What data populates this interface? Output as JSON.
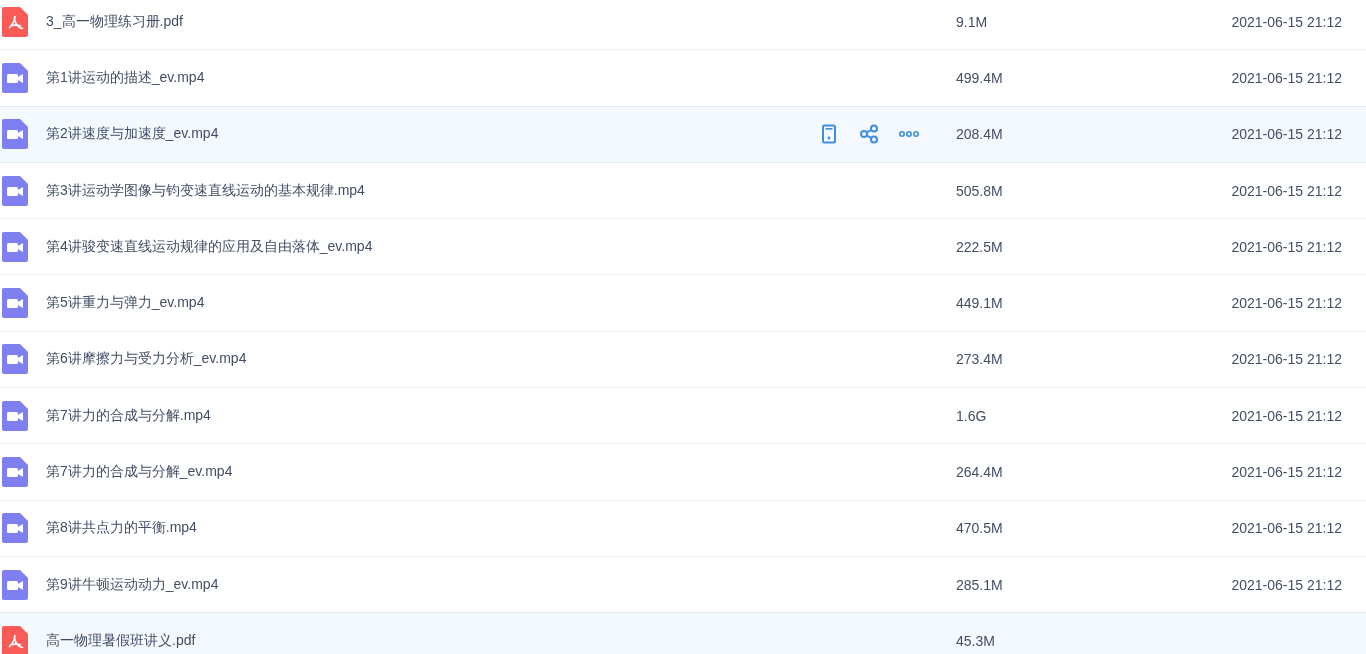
{
  "files": [
    {
      "kind": "pdf",
      "name": "3_高一物理练习册.pdf",
      "size": "9.1M",
      "date": "2021-06-15 21:12",
      "highlighted": false,
      "show_actions": false
    },
    {
      "kind": "video",
      "name": "第1讲运动的描述_ev.mp4",
      "size": "499.4M",
      "date": "2021-06-15 21:12",
      "highlighted": false,
      "show_actions": false
    },
    {
      "kind": "video",
      "name": "第2讲速度与加速度_ev.mp4",
      "size": "208.4M",
      "date": "2021-06-15 21:12",
      "highlighted": true,
      "show_actions": true
    },
    {
      "kind": "video",
      "name": "第3讲运动学图像与钧变速直线运动的基本规律.mp4",
      "size": "505.8M",
      "date": "2021-06-15 21:12",
      "highlighted": false,
      "show_actions": false
    },
    {
      "kind": "video",
      "name": "第4讲骏变速直线运动规律的应用及自由落体_ev.mp4",
      "size": "222.5M",
      "date": "2021-06-15 21:12",
      "highlighted": false,
      "show_actions": false
    },
    {
      "kind": "video",
      "name": "第5讲重力与弹力_ev.mp4",
      "size": "449.1M",
      "date": "2021-06-15 21:12",
      "highlighted": false,
      "show_actions": false
    },
    {
      "kind": "video",
      "name": "第6讲摩擦力与受力分析_ev.mp4",
      "size": "273.4M",
      "date": "2021-06-15 21:12",
      "highlighted": false,
      "show_actions": false
    },
    {
      "kind": "video",
      "name": "第7讲力的合成与分解.mp4",
      "size": "1.6G",
      "date": "2021-06-15 21:12",
      "highlighted": false,
      "show_actions": false
    },
    {
      "kind": "video",
      "name": "第7讲力的合成与分解_ev.mp4",
      "size": "264.4M",
      "date": "2021-06-15 21:12",
      "highlighted": false,
      "show_actions": false
    },
    {
      "kind": "video",
      "name": "第8讲共点力的平衡.mp4",
      "size": "470.5M",
      "date": "2021-06-15 21:12",
      "highlighted": false,
      "show_actions": false
    },
    {
      "kind": "video",
      "name": "第9讲牛顿运动动力_ev.mp4",
      "size": "285.1M",
      "date": "2021-06-15 21:12",
      "highlighted": false,
      "show_actions": false
    },
    {
      "kind": "pdf",
      "name": "高一物理暑假班讲义.pdf",
      "size": "45.3M",
      "highlighted": true,
      "show_actions": false
    }
  ]
}
